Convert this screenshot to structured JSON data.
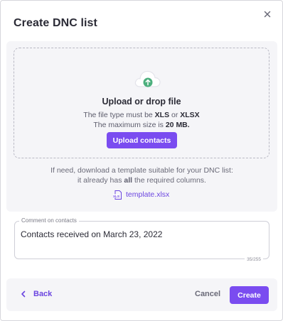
{
  "dialog": {
    "title": "Create DNC list"
  },
  "upload": {
    "drop_title": "Upload or drop file",
    "type_prefix": "The file type must be ",
    "type_a": "XLS",
    "type_or": " or ",
    "type_b": "XLSX",
    "size_prefix": "The maximum size is ",
    "size_value": "20 MB.",
    "button_label": "Upload contacts"
  },
  "template": {
    "line1": "If need, download a template suitable for your DNC list:",
    "line2_prefix": "it already has ",
    "line2_bold": "all",
    "line2_suffix": " the required columns.",
    "file_name": "template.xlsx"
  },
  "comment": {
    "label": "Comment on contacts",
    "value": "Contacts received on March 23, 2022",
    "counter": "35/255"
  },
  "footer": {
    "back_label": "Back",
    "cancel_label": "Cancel",
    "create_label": "Create"
  },
  "colors": {
    "accent": "#7a4cf0",
    "link": "#6b45e0",
    "panel": "#f5f5f8",
    "cloud_badge": "#4caf7d"
  },
  "icons": {
    "close": "close-icon",
    "cloud": "cloud-upload-icon",
    "file": "xls-file-icon",
    "back": "chevron-left-icon"
  }
}
